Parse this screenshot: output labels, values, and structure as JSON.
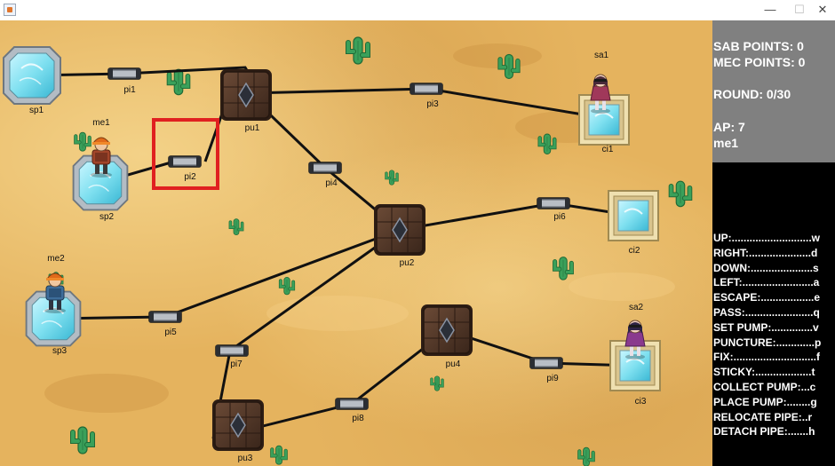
{
  "window": {
    "minimize_glyph": "—",
    "maximize_glyph": "☐",
    "close_glyph": "✕"
  },
  "status": {
    "sab_points": "SAB POINTS: 0",
    "mec_points": "MEC POINTS: 0",
    "round": "ROUND: 0/30",
    "ap": "AP: 7",
    "current_player": "me1"
  },
  "controls": [
    "UP:...........................w",
    "RIGHT:.....................d",
    "DOWN:.....................s",
    "LEFT:........................a",
    "ESCAPE:..................e",
    "PASS:.......................q",
    "SET PUMP:..............v",
    "PUNCTURE:.............p",
    "FIX:............................f",
    "STICKY:...................t",
    "COLLECT PUMP:...c",
    "PLACE PUMP:........g",
    "RELOCATE PIPE:..r",
    "DETACH PIPE:.......h"
  ],
  "board": {
    "springs": [
      {
        "id": "sp1",
        "label": "sp1"
      },
      {
        "id": "sp2",
        "label": "sp2"
      },
      {
        "id": "sp3",
        "label": "sp3"
      }
    ],
    "cisterns": [
      {
        "id": "ci1",
        "label": "ci1"
      },
      {
        "id": "ci2",
        "label": "ci2"
      },
      {
        "id": "ci3",
        "label": "ci3"
      }
    ],
    "pumps": [
      {
        "id": "pu1",
        "label": "pu1"
      },
      {
        "id": "pu2",
        "label": "pu2"
      },
      {
        "id": "pu3",
        "label": "pu3"
      },
      {
        "id": "pu4",
        "label": "pu4"
      }
    ],
    "pipes": [
      {
        "id": "pi1",
        "label": "pi1"
      },
      {
        "id": "pi2",
        "label": "pi2"
      },
      {
        "id": "pi3",
        "label": "pi3"
      },
      {
        "id": "pi4",
        "label": "pi4"
      },
      {
        "id": "pi5",
        "label": "pi5"
      },
      {
        "id": "pi6",
        "label": "pi6"
      },
      {
        "id": "pi7",
        "label": "pi7"
      },
      {
        "id": "pi8",
        "label": "pi8"
      },
      {
        "id": "pi9",
        "label": "pi9"
      }
    ],
    "players": [
      {
        "id": "me1",
        "label": "me1",
        "role": "mechanic",
        "on": "sp2"
      },
      {
        "id": "me2",
        "label": "me2",
        "role": "mechanic",
        "on": "sp3"
      },
      {
        "id": "sa1",
        "label": "sa1",
        "role": "saboteur",
        "on": "ci1"
      },
      {
        "id": "sa2",
        "label": "sa2",
        "role": "saboteur",
        "on": "ci3"
      }
    ],
    "selected": "pi2",
    "colors": {
      "sand": "#e5b35e",
      "cactus": "#3aa05a",
      "pump_body": "#4e3426",
      "spring_frame": "#b3bcc4",
      "cistern_frame": "#d9c48d",
      "water": "#7fe0f0",
      "selection": "#e02020"
    }
  }
}
